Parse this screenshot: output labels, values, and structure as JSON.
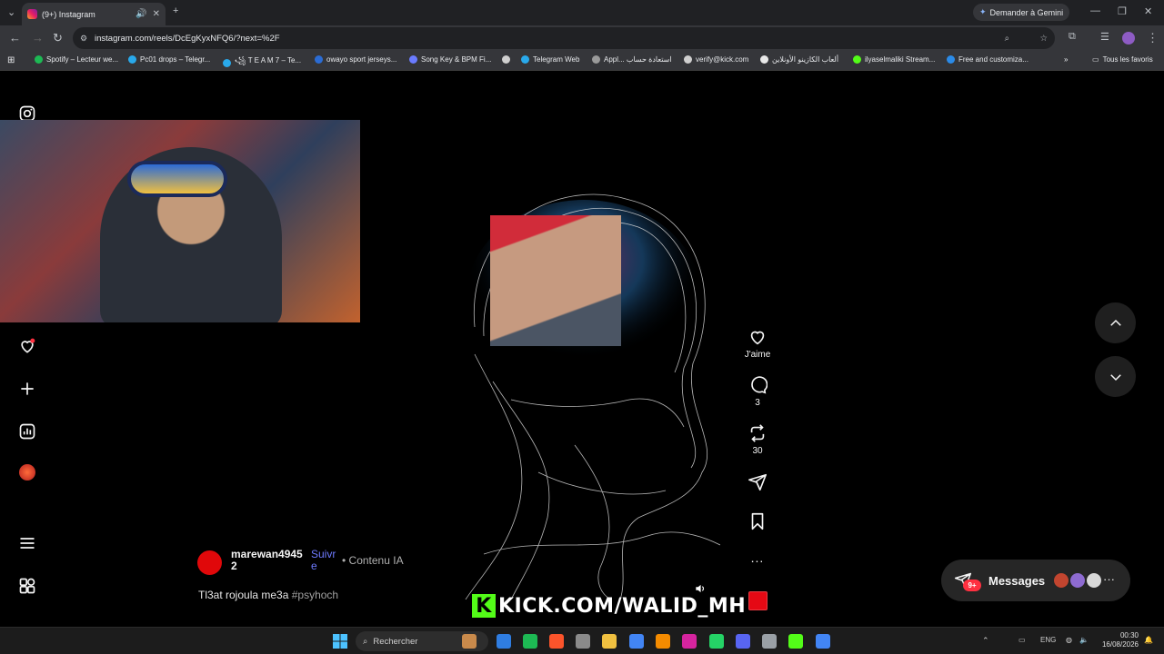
{
  "browser": {
    "tab_title": "(9+) Instagram",
    "gemini_button": "Demander à Gemini",
    "url": "instagram.com/reels/DcEgKyxNFQ6/?next=%2F",
    "bookmarks": [
      {
        "label": "Spotify – Lecteur we...",
        "color": "#1db954"
      },
      {
        "label": "Pc01 drops – Telegr...",
        "color": "#29a9eb"
      },
      {
        "label": "꧁ T E A M 7 – Te...",
        "color": "#29a9eb"
      },
      {
        "label": "owayo sport jerseys...",
        "color": "#2b6cd4"
      },
      {
        "label": "Song Key & BPM Fi...",
        "color": "#6a7bff"
      },
      {
        "label": "",
        "color": "#cfcfcf"
      },
      {
        "label": "Telegram Web",
        "color": "#29a9eb"
      },
      {
        "label": "Appl... استعادة حساب",
        "color": "#9a9a9a"
      },
      {
        "label": "verify@kick.com",
        "color": "#cfcfcf"
      },
      {
        "label": "ألعاب الكازينو الأونلاين",
        "color": "#e8e8e8"
      },
      {
        "label": "ilyaselmaliki Stream...",
        "color": "#53fc18"
      },
      {
        "label": "Free and customiza...",
        "color": "#2b8be8"
      }
    ],
    "all_bookmarks": "Tous les favoris"
  },
  "reel": {
    "overlay_text": "KICK.COM/WALID_MH",
    "author": "marewan49452",
    "follow": "Suivre",
    "ai_label": "• Contenu IA",
    "caption_text": "Tl3at rojoula me3a",
    "caption_tag": "#psyhoch",
    "like_label": "J'aime",
    "comments_count": "3",
    "reposts_count": "30",
    "more": "..."
  },
  "messages": {
    "label": "Messages",
    "badge": "9+"
  },
  "taskbar": {
    "search": "Rechercher",
    "lang": "ENG",
    "time": "00:30",
    "date": "16/08/2026"
  },
  "colors": {
    "accent_follow": "#6e7bff",
    "badge_red": "#ff3040",
    "kick_green": "#53fc18"
  }
}
